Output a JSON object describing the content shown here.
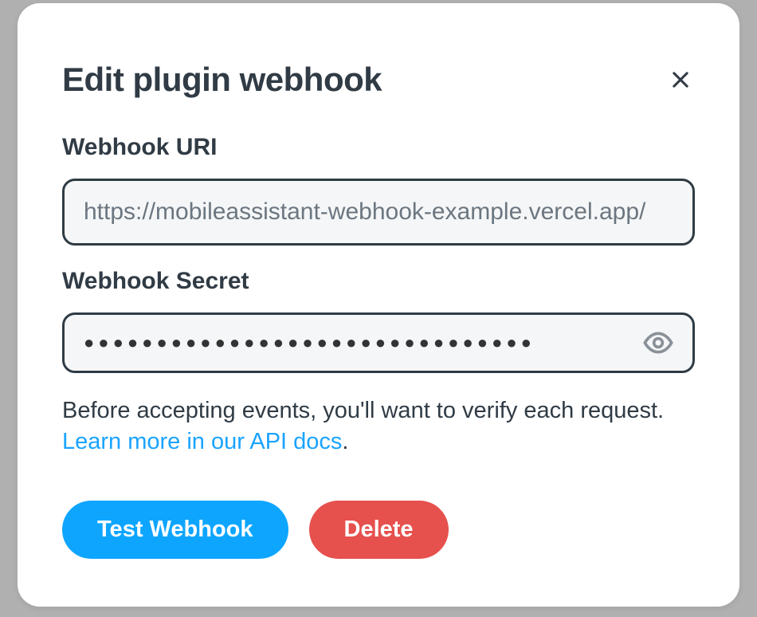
{
  "modal": {
    "title": "Edit plugin webhook",
    "fields": {
      "uri": {
        "label": "Webhook URI",
        "value": "https://mobileassistant-webhook-example.vercel.app/"
      },
      "secret": {
        "label": "Webhook Secret",
        "value": "●●●●●●●●●●●●●●●●●●●●●●●●●●●●●●●"
      }
    },
    "helper": {
      "text_before": "Before accepting events, you'll want to verify each request. ",
      "link_text": "Learn more in our API docs",
      "text_after": "."
    },
    "buttons": {
      "test": "Test Webhook",
      "delete": "Delete"
    }
  }
}
